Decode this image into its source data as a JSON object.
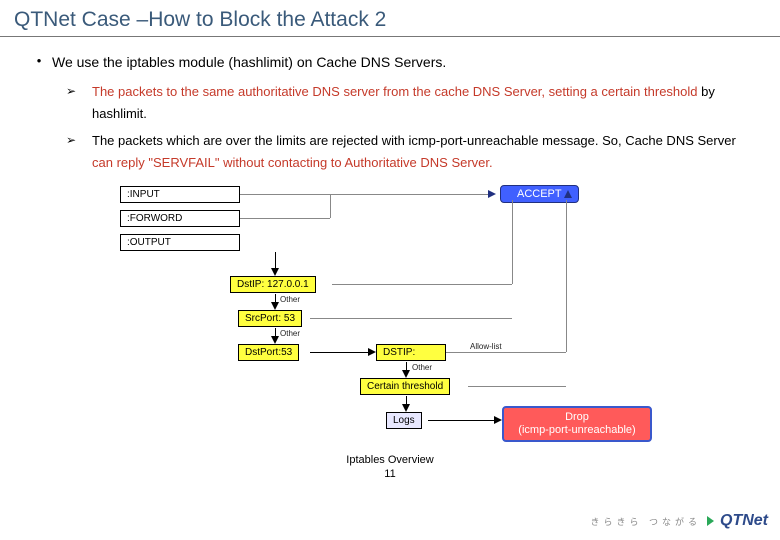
{
  "title": "QTNet Case  –How to Block the Attack 2",
  "bullet": "We use the iptables module (hashlimit) on Cache DNS Servers.",
  "sub": [
    {
      "prefix": "The packets to the same authoritative DNS server from the cache DNS Server, setting a certain threshold",
      "suffix": " by hashlimit."
    },
    {
      "plain1": "The packets which are over the limits are rejected with icmp-port-unreachable message. So, Cache DNS Server ",
      "hl1": "can reply \"SERVFAIL\" without contacting to Authoritative  DNS Server."
    }
  ],
  "diagram": {
    "chains": {
      "input": ":INPUT",
      "forward": ":FORWORD",
      "output": ":OUTPUT"
    },
    "nodes": {
      "accept": "ACCEPT",
      "dstip_lo": "DstIP: 127.0.0.1",
      "srcport": "SrcPort: 53",
      "dstport": "DstPort:53",
      "dstip": "DSTIP:",
      "threshold": "Certain threshold",
      "logs": "Logs",
      "drop_l1": "Drop",
      "drop_l2": "(icmp-port-unreachable)"
    },
    "labels": {
      "other": "Other",
      "other2": "Other",
      "other3": "Other",
      "allowlist": "Allow-list"
    }
  },
  "caption": "Iptables Overview",
  "page": "11",
  "footer": {
    "tagline": "きらきら つながる",
    "brand": "QTNet"
  }
}
